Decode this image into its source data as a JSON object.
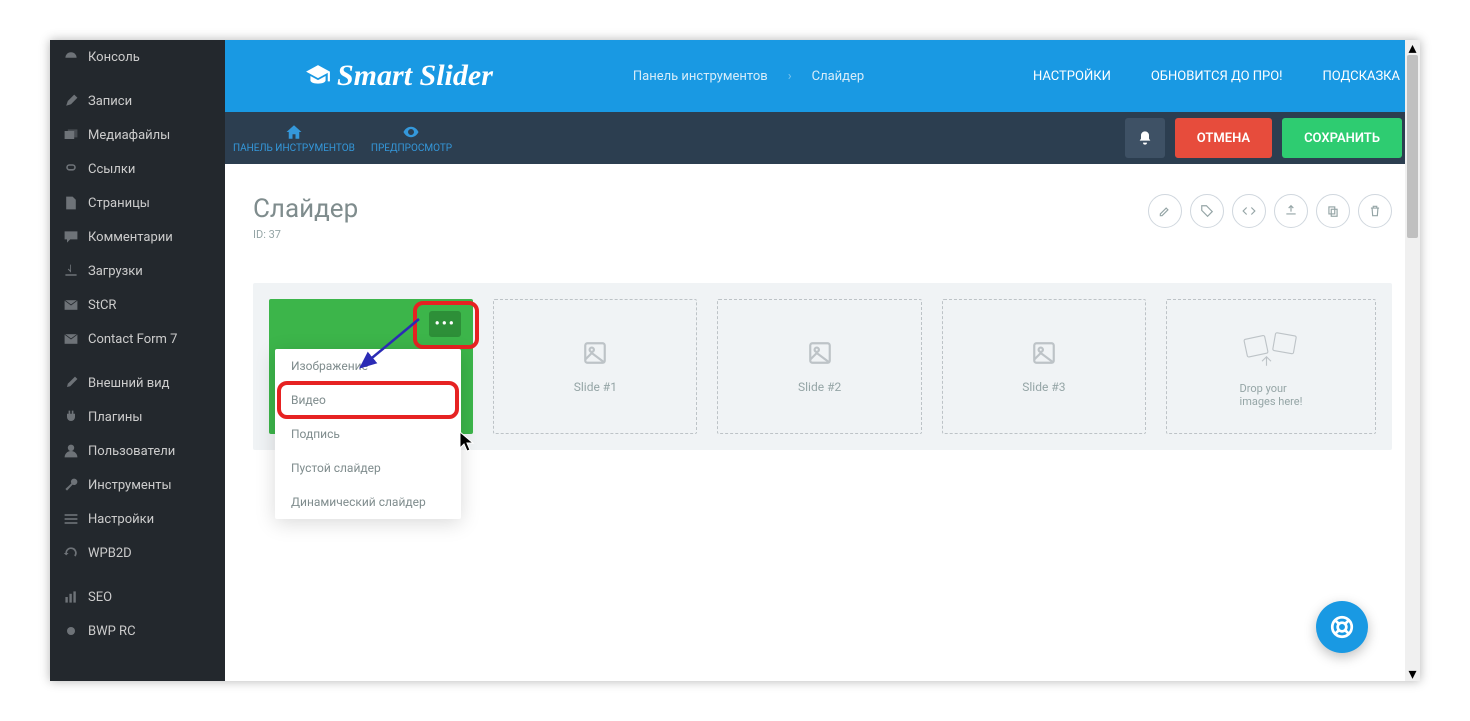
{
  "sidebar": {
    "items": [
      {
        "label": "Консоль"
      },
      {
        "label": "Записи"
      },
      {
        "label": "Медиафайлы"
      },
      {
        "label": "Ссылки"
      },
      {
        "label": "Страницы"
      },
      {
        "label": "Комментарии"
      },
      {
        "label": "Загрузки"
      },
      {
        "label": "StCR"
      },
      {
        "label": "Contact Form 7"
      },
      {
        "label": "Внешний вид"
      },
      {
        "label": "Плагины"
      },
      {
        "label": "Пользователи"
      },
      {
        "label": "Инструменты"
      },
      {
        "label": "Настройки"
      },
      {
        "label": "WPB2D"
      },
      {
        "label": "SEO"
      },
      {
        "label": "BWP RC"
      }
    ]
  },
  "topbar": {
    "logo": "Smart Slider",
    "crumb1": "Панель инструментов",
    "crumb2": "Слайдер",
    "links": {
      "settings": "НАСТРОЙКИ",
      "upgrade": "ОБНОВИТСЯ ДО ПРО!",
      "hint": "ПОДСКАЗКА"
    }
  },
  "toolbar": {
    "home": "ПАНЕЛЬ ИНСТРУМЕНТОВ",
    "preview": "ПРЕДПРОСМОТР",
    "cancel": "ОТМЕНА",
    "save": "СОХРАНИТЬ"
  },
  "page": {
    "title": "Слайдер",
    "id_label": "ID: 37"
  },
  "slots": {
    "s1": "Slide #1",
    "s2": "Slide #2",
    "s3": "Slide #3",
    "drop1": "Drop your",
    "drop2": "images here!"
  },
  "dropdown": {
    "image": "Изображение",
    "video": "Видео",
    "caption": "Подпись",
    "empty": "Пустой слайдер",
    "dynamic": "Динамический слайдер"
  }
}
